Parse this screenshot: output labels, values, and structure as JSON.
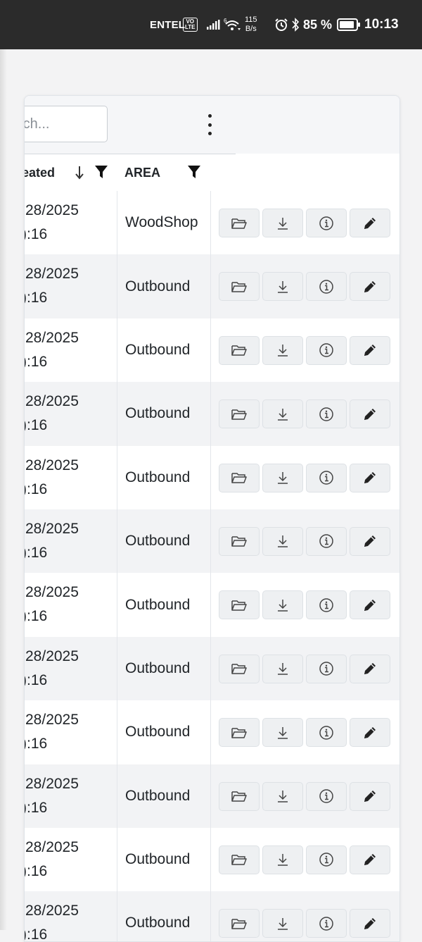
{
  "status_bar": {
    "carrier": "ENTEL",
    "volte_top": "VO",
    "volte_bottom": "LTE",
    "signal_gen": "6",
    "speed_value": "115",
    "speed_unit": "B/s",
    "battery_percent": "85 %",
    "time": "10:13"
  },
  "toolbar": {
    "search_placeholder": "rch..."
  },
  "table": {
    "columns": {
      "created": "eated",
      "area": "AREA"
    },
    "rows": [
      {
        "date": "28/2025",
        "time": "):16",
        "area": "WoodShop"
      },
      {
        "date": "28/2025",
        "time": "):16",
        "area": "Outbound"
      },
      {
        "date": "28/2025",
        "time": "):16",
        "area": "Outbound"
      },
      {
        "date": "28/2025",
        "time": "):16",
        "area": "Outbound"
      },
      {
        "date": "28/2025",
        "time": "):16",
        "area": "Outbound"
      },
      {
        "date": "28/2025",
        "time": "):16",
        "area": "Outbound"
      },
      {
        "date": "28/2025",
        "time": "):16",
        "area": "Outbound"
      },
      {
        "date": "28/2025",
        "time": "):16",
        "area": "Outbound"
      },
      {
        "date": "28/2025",
        "time": "):16",
        "area": "Outbound"
      },
      {
        "date": "28/2025",
        "time": "):16",
        "area": "Outbound"
      },
      {
        "date": "28/2025",
        "time": "):16",
        "area": "Outbound"
      },
      {
        "date": "28/2025",
        "time": "):16",
        "area": "Outbound"
      }
    ],
    "row_actions": [
      "folder-open-icon",
      "download-icon",
      "info-icon",
      "pencil-icon"
    ]
  }
}
